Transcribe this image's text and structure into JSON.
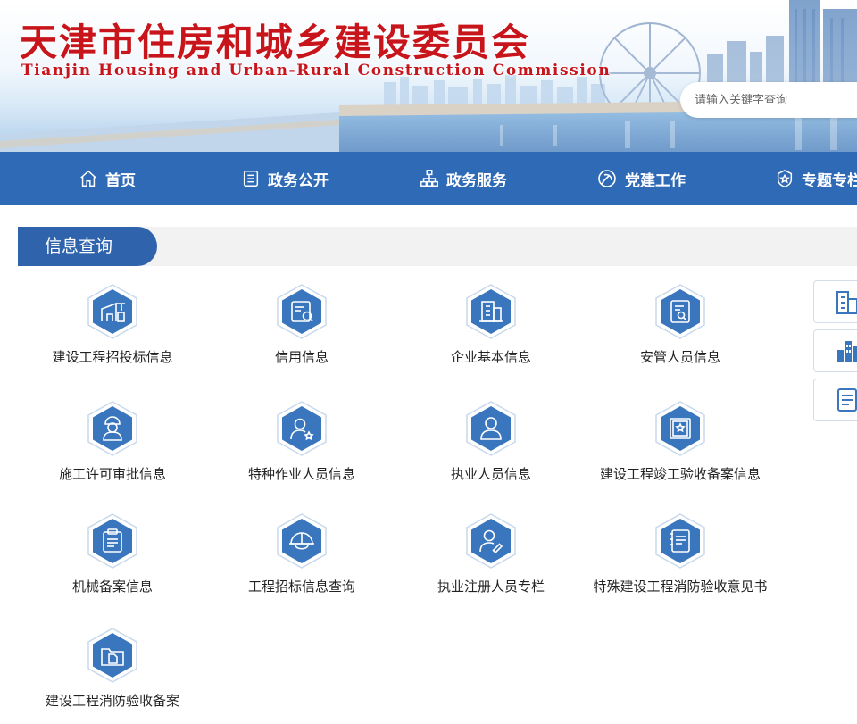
{
  "header": {
    "title": "天津市住房和城乡建设委员会",
    "subtitle": "Tianjin Housing and Urban-Rural Construction Commission"
  },
  "search": {
    "placeholder": "请输入关键字查询"
  },
  "nav": {
    "items": [
      {
        "label": "首页",
        "icon": "home-icon"
      },
      {
        "label": "政务公开",
        "icon": "document-list-icon"
      },
      {
        "label": "政务服务",
        "icon": "org-chart-icon"
      },
      {
        "label": "党建工作",
        "icon": "party-emblem-icon"
      },
      {
        "label": "专题专栏",
        "icon": "badge-star-icon"
      }
    ]
  },
  "section": {
    "title": "信息查询"
  },
  "items": [
    {
      "label": "建设工程招投标信息",
      "icon": "crane-building-icon"
    },
    {
      "label": "信用信息",
      "icon": "credit-search-icon"
    },
    {
      "label": "企业基本信息",
      "icon": "office-building-icon"
    },
    {
      "label": "安管人员信息",
      "icon": "document-search-icon"
    },
    {
      "label": "施工许可审批信息",
      "icon": "construction-worker-icon"
    },
    {
      "label": "特种作业人员信息",
      "icon": "person-star-icon"
    },
    {
      "label": "执业人员信息",
      "icon": "person-icon"
    },
    {
      "label": "建设工程竣工验收备案信息",
      "icon": "certificate-icon"
    },
    {
      "label": "机械备案信息",
      "icon": "clipboard-icon"
    },
    {
      "label": "工程招标信息查询",
      "icon": "safety-helmet-icon"
    },
    {
      "label": "执业注册人员专栏",
      "icon": "person-pen-icon"
    },
    {
      "label": "特殊建设工程消防验收意见书",
      "icon": "notebook-icon"
    },
    {
      "label": "建设工程消防验收备案",
      "icon": "folder-document-icon"
    }
  ],
  "side_buttons": [
    {
      "icon": "building-icon"
    },
    {
      "icon": "city-buildings-icon"
    },
    {
      "icon": "list-document-icon"
    }
  ],
  "colors": {
    "nav_bg": "#2f6ab7",
    "title_red": "#c8141b",
    "icon_blue": "#3a76bd",
    "section_tab": "#2f64ad"
  }
}
